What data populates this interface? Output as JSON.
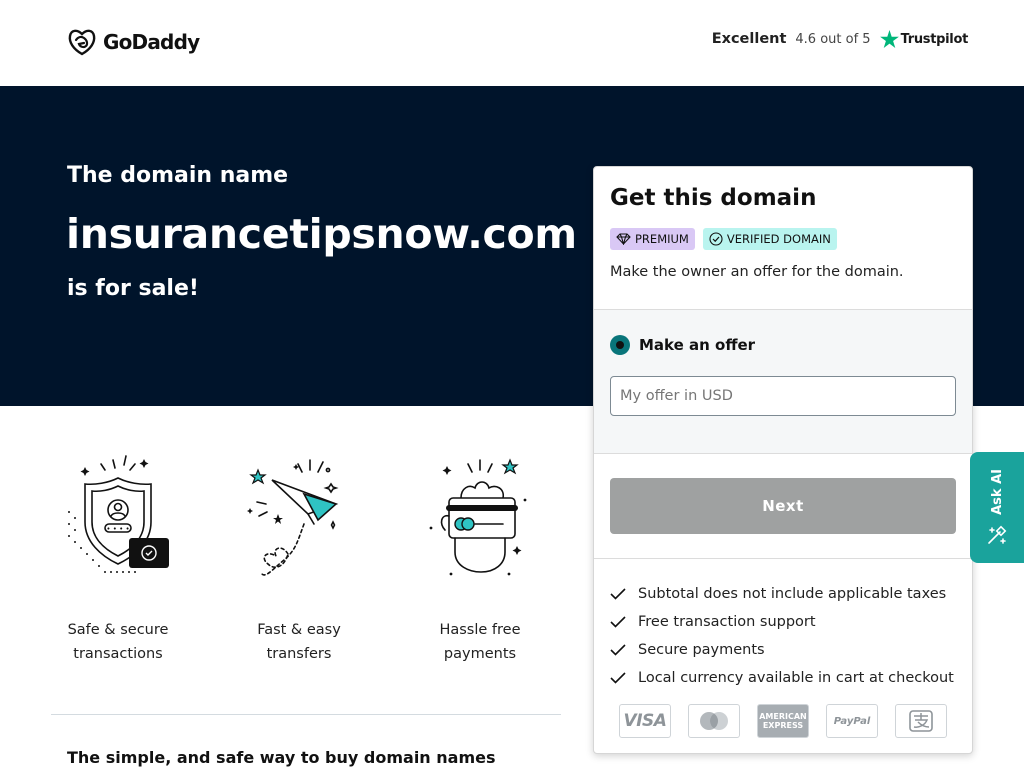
{
  "header": {
    "logo_text": "GoDaddy",
    "rating_word": "Excellent",
    "rating_score": "4.6 out of 5",
    "rating_brand": "Trustpilot",
    "trustpilot_color": "#00b67a"
  },
  "hero": {
    "pre": "The domain name",
    "domain": "insurancetipsnow.com",
    "post": "is for sale!",
    "background": "#00142b"
  },
  "features": [
    {
      "label_line1": "Safe & secure",
      "label_line2": "transactions",
      "icon": "shield-user-icon"
    },
    {
      "label_line1": "Fast & easy",
      "label_line2": "transfers",
      "icon": "paper-plane-icon"
    },
    {
      "label_line1": "Hassle free",
      "label_line2": "payments",
      "icon": "hand-card-icon"
    }
  ],
  "bottom_heading": "The simple, and safe way to buy domain names",
  "card": {
    "title": "Get this domain",
    "badge_premium": "PREMIUM",
    "badge_verified": "VERIFIED DOMAIN",
    "description": "Make the owner an offer for the domain.",
    "radio_label": "Make an offer",
    "offer_placeholder": "My offer in USD",
    "offer_value": "",
    "next_label": "Next",
    "checks": [
      "Subtotal does not include applicable taxes",
      "Free transaction support",
      "Secure payments",
      "Local currency available in cart at checkout"
    ],
    "payment_methods": {
      "visa": "VISA",
      "mastercard": "",
      "amex": "AMERICAN EXPRESS",
      "paypal": "PayPal",
      "alipay": ""
    },
    "accent_color": "#09757a"
  },
  "askai": {
    "label": "Ask AI",
    "background": "#1aa39c"
  }
}
